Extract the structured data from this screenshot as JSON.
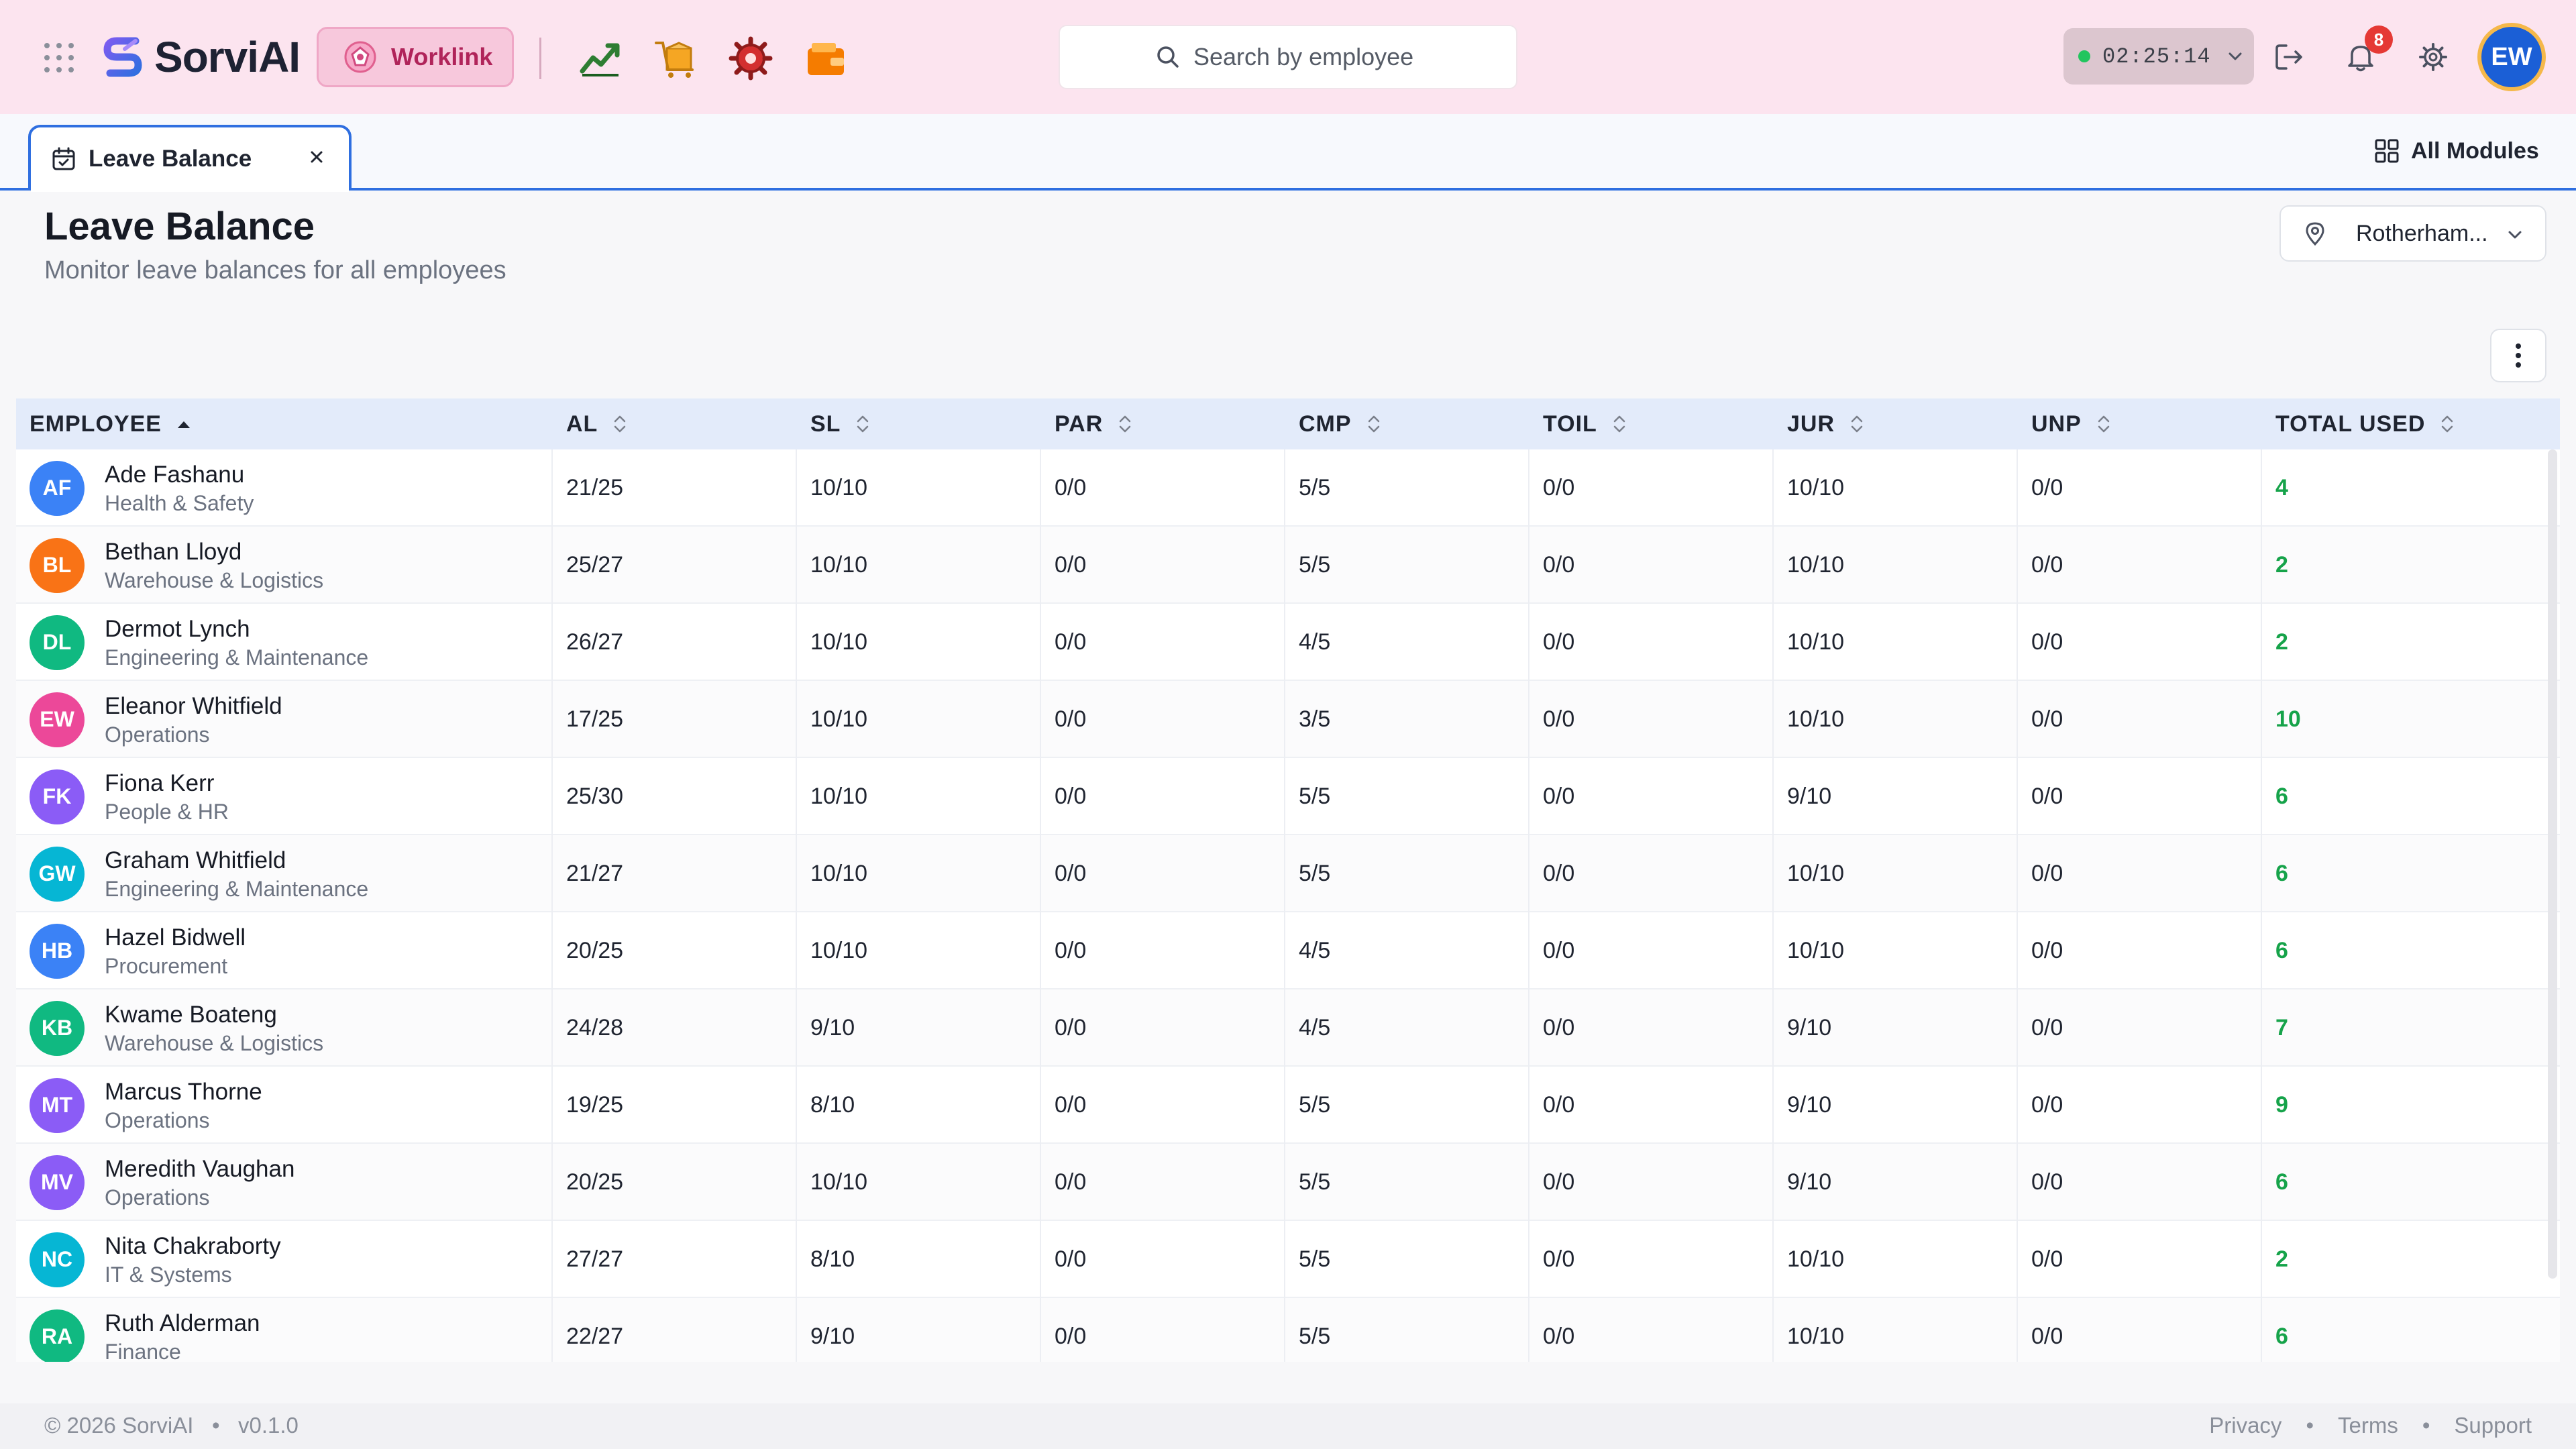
{
  "app": {
    "brand": "SorviAI",
    "active_module": "Worklink"
  },
  "search": {
    "placeholder": "Search by employee"
  },
  "timer": {
    "value": "02:25:14",
    "status_color": "#22c55e"
  },
  "notifications": {
    "count": "8"
  },
  "user": {
    "initials": "EW"
  },
  "tabs": [
    {
      "label": "Leave Balance",
      "icon": "calendar-icon"
    }
  ],
  "all_modules_label": "All Modules",
  "page": {
    "title": "Leave Balance",
    "subtitle": "Monitor leave balances for all employees",
    "location": "Rotherham..."
  },
  "table": {
    "columns": [
      "EMPLOYEE",
      "AL",
      "SL",
      "PAR",
      "CMP",
      "TOIL",
      "JUR",
      "UNP",
      "TOTAL USED"
    ],
    "sorted_column": "EMPLOYEE",
    "sort_direction": "asc",
    "rows": [
      {
        "initials": "AF",
        "color": "#3b82f6",
        "name": "Ade Fashanu",
        "dept": "Health & Safety",
        "al": "21/25",
        "sl": "10/10",
        "par": "0/0",
        "cmp": "5/5",
        "toil": "0/0",
        "jur": "10/10",
        "unp": "0/0",
        "total": "4"
      },
      {
        "initials": "BL",
        "color": "#f97316",
        "name": "Bethan Lloyd",
        "dept": "Warehouse & Logistics",
        "al": "25/27",
        "sl": "10/10",
        "par": "0/0",
        "cmp": "5/5",
        "toil": "0/0",
        "jur": "10/10",
        "unp": "0/0",
        "total": "2"
      },
      {
        "initials": "DL",
        "color": "#10b981",
        "name": "Dermot Lynch",
        "dept": "Engineering & Maintenance",
        "al": "26/27",
        "sl": "10/10",
        "par": "0/0",
        "cmp": "4/5",
        "toil": "0/0",
        "jur": "10/10",
        "unp": "0/0",
        "total": "2"
      },
      {
        "initials": "EW",
        "color": "#ec4899",
        "name": "Eleanor Whitfield",
        "dept": "Operations",
        "al": "17/25",
        "sl": "10/10",
        "par": "0/0",
        "cmp": "3/5",
        "toil": "0/0",
        "jur": "10/10",
        "unp": "0/0",
        "total": "10"
      },
      {
        "initials": "FK",
        "color": "#8b5cf6",
        "name": "Fiona Kerr",
        "dept": "People & HR",
        "al": "25/30",
        "sl": "10/10",
        "par": "0/0",
        "cmp": "5/5",
        "toil": "0/0",
        "jur": "9/10",
        "unp": "0/0",
        "total": "6"
      },
      {
        "initials": "GW",
        "color": "#06b6d4",
        "name": "Graham Whitfield",
        "dept": "Engineering & Maintenance",
        "al": "21/27",
        "sl": "10/10",
        "par": "0/0",
        "cmp": "5/5",
        "toil": "0/0",
        "jur": "10/10",
        "unp": "0/0",
        "total": "6"
      },
      {
        "initials": "HB",
        "color": "#3b82f6",
        "name": "Hazel Bidwell",
        "dept": "Procurement",
        "al": "20/25",
        "sl": "10/10",
        "par": "0/0",
        "cmp": "4/5",
        "toil": "0/0",
        "jur": "10/10",
        "unp": "0/0",
        "total": "6"
      },
      {
        "initials": "KB",
        "color": "#10b981",
        "name": "Kwame Boateng",
        "dept": "Warehouse & Logistics",
        "al": "24/28",
        "sl": "9/10",
        "par": "0/0",
        "cmp": "4/5",
        "toil": "0/0",
        "jur": "9/10",
        "unp": "0/0",
        "total": "7"
      },
      {
        "initials": "MT",
        "color": "#8b5cf6",
        "name": "Marcus Thorne",
        "dept": "Operations",
        "al": "19/25",
        "sl": "8/10",
        "par": "0/0",
        "cmp": "5/5",
        "toil": "0/0",
        "jur": "9/10",
        "unp": "0/0",
        "total": "9"
      },
      {
        "initials": "MV",
        "color": "#8b5cf6",
        "name": "Meredith Vaughan",
        "dept": "Operations",
        "al": "20/25",
        "sl": "10/10",
        "par": "0/0",
        "cmp": "5/5",
        "toil": "0/0",
        "jur": "9/10",
        "unp": "0/0",
        "total": "6"
      },
      {
        "initials": "NC",
        "color": "#06b6d4",
        "name": "Nita Chakraborty",
        "dept": "IT & Systems",
        "al": "27/27",
        "sl": "8/10",
        "par": "0/0",
        "cmp": "5/5",
        "toil": "0/0",
        "jur": "10/10",
        "unp": "0/0",
        "total": "2"
      },
      {
        "initials": "RA",
        "color": "#10b981",
        "name": "Ruth Alderman",
        "dept": "Finance",
        "al": "22/27",
        "sl": "9/10",
        "par": "0/0",
        "cmp": "5/5",
        "toil": "0/0",
        "jur": "10/10",
        "unp": "0/0",
        "total": "6"
      }
    ]
  },
  "footer": {
    "copyright": "© 2026 SorviAI",
    "version": "v0.1.0",
    "links": [
      "Privacy",
      "Terms",
      "Support"
    ]
  },
  "colors": {
    "topbar_bg": "#fce4ef",
    "accent_blue": "#2f6fe0",
    "total_green": "#16a34a",
    "worklink_text": "#b0245a"
  }
}
